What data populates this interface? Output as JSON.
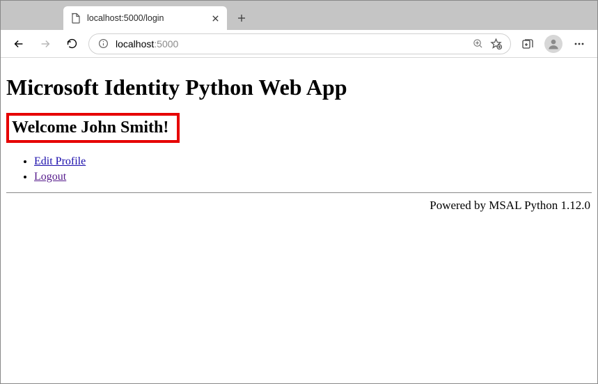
{
  "browser": {
    "tab_title": "localhost:5000/login",
    "url_host": "localhost",
    "url_rest": ":5000"
  },
  "page": {
    "heading": "Microsoft Identity Python Web App",
    "welcome": "Welcome John Smith!",
    "links": {
      "edit_profile": "Edit Profile",
      "logout": "Logout"
    },
    "footer": "Powered by MSAL Python 1.12.0"
  }
}
